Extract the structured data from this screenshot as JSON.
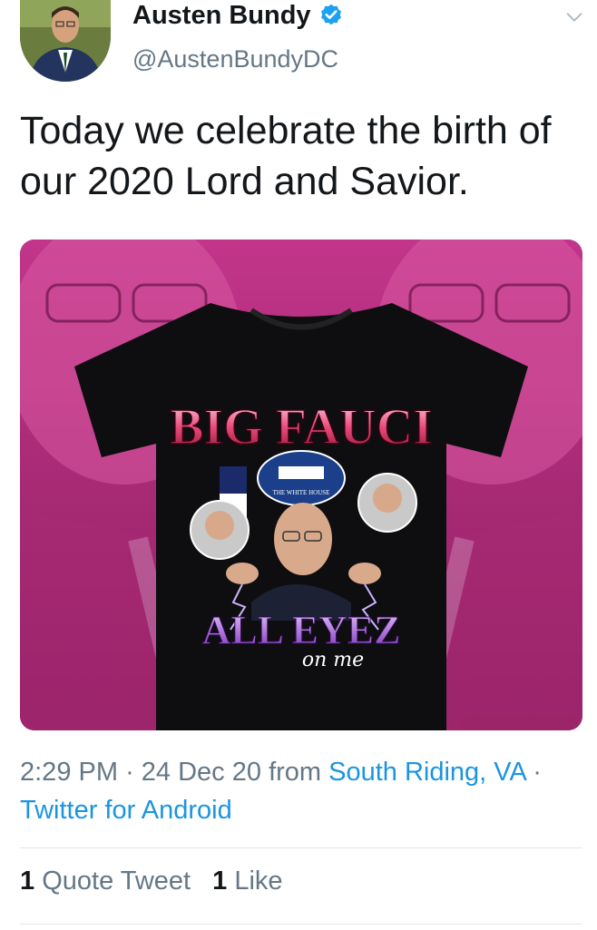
{
  "user": {
    "display_name": "Austen Bundy",
    "handle": "@AustenBundyDC"
  },
  "tweet": {
    "text": "Today we celebrate the birth of our 2020 Lord and Savior."
  },
  "media": {
    "shirt_title": "BIG FAUCI",
    "seal_text": "THE WHITE HOUSE",
    "shirt_subtitle": "ALL EYEZ",
    "shirt_script": "on me"
  },
  "meta": {
    "time": "2:29 PM",
    "separator": "·",
    "date": "24 Dec 20",
    "from_word": "from",
    "location": "South Riding, VA",
    "source": "Twitter for Android"
  },
  "stats": {
    "quote_count": "1",
    "quote_label": "Quote Tweet",
    "like_count": "1",
    "like_label": "Like"
  },
  "colors": {
    "link": "#1b95e0",
    "verified": "#1da1f2",
    "media_background": "#b8297e"
  }
}
